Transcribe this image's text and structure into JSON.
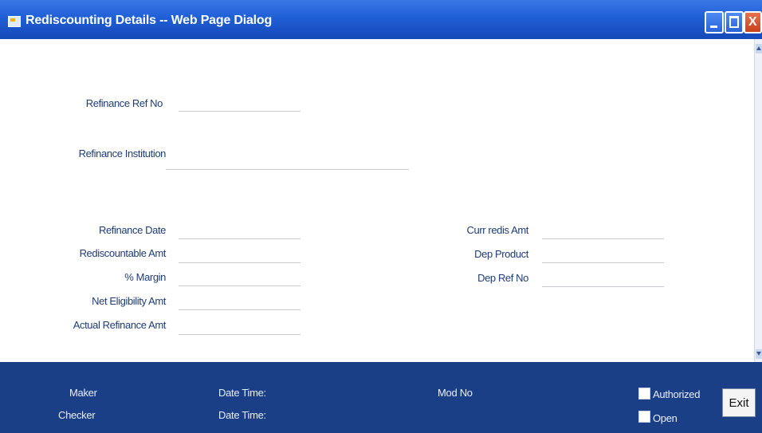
{
  "window": {
    "title": "Rediscounting Details -- Web Page Dialog"
  },
  "form": {
    "refinance_ref_no": {
      "label": "Refinance Ref No",
      "value": ""
    },
    "refinance_institution": {
      "label": "Refinance Institution",
      "value": ""
    },
    "refinance_date": {
      "label": "Refinance Date",
      "value": ""
    },
    "rediscountable_amt": {
      "label": "Rediscountable Amt",
      "value": ""
    },
    "margin": {
      "label": "% Margin",
      "value": ""
    },
    "net_eligibility_amt": {
      "label": "Net Eligibility Amt",
      "value": ""
    },
    "actual_refinance_amt": {
      "label": "Actual Refinance Amt",
      "value": ""
    },
    "curr_redis_amt": {
      "label": "Curr redis Amt",
      "value": ""
    },
    "dep_product": {
      "label": "Dep Product",
      "value": ""
    },
    "dep_ref_no": {
      "label": "Dep Ref No",
      "value": ""
    }
  },
  "footer": {
    "maker": "Maker",
    "checker": "Checker",
    "date_time_1": "Date Time:",
    "date_time_2": "Date Time:",
    "mod_no": "Mod No",
    "authorized": "Authorized",
    "open": "Open",
    "exit": "Exit"
  },
  "colors": {
    "titlebar": "#1f5fd6",
    "footer": "#1b3f86",
    "label": "#1e3c78"
  }
}
